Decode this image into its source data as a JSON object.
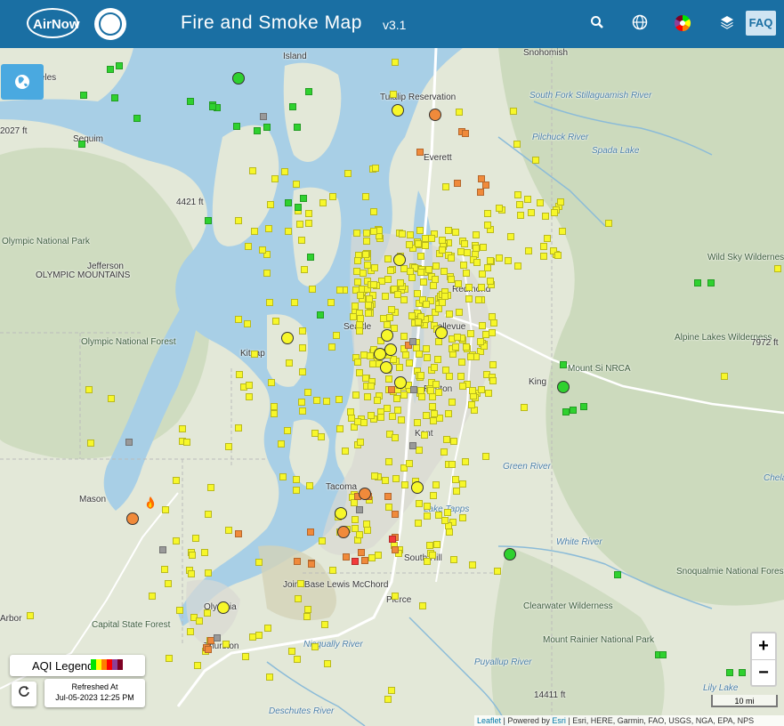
{
  "header": {
    "logo_text": "AirNow",
    "title": "Fire and Smoke Map",
    "version": "v3.1",
    "faq_label": "FAQ",
    "icons": [
      "search-icon",
      "globe-icon",
      "color-wheel-icon",
      "layers-icon"
    ]
  },
  "legend": {
    "label": "AQI Legend",
    "colors": [
      "#00e400",
      "#ffff00",
      "#ff7e00",
      "#ff0000",
      "#8f3f97",
      "#7e0023"
    ]
  },
  "refresh": {
    "title": "Refreshed At",
    "time": "Jul-05-2023 12:25 PM"
  },
  "zoom": {
    "in": "+",
    "out": "−"
  },
  "scale": "10 mi",
  "attribution": {
    "leaflet": "Leaflet",
    "sep1": " | Powered by ",
    "esri": "Esri",
    "rest": " | Esri, HERE, Garmin, FAO, USGS, NGA, EPA, NPS"
  },
  "places": [
    {
      "name": "t Angeles",
      "type": "city"
    },
    {
      "name": "Island",
      "type": "city"
    },
    {
      "name": "Snohomish",
      "type": "city"
    },
    {
      "name": "Tulalip Reservation",
      "type": "city"
    },
    {
      "name": "South Fork Stillaguamish River",
      "type": "river"
    },
    {
      "name": "Pilchuck River",
      "type": "river"
    },
    {
      "name": "Sequim",
      "type": "city"
    },
    {
      "name": "Everett",
      "type": "city"
    },
    {
      "name": "Spada Lake",
      "type": "river"
    },
    {
      "name": "4421 ft",
      "type": "city"
    },
    {
      "name": "Olympic National Park",
      "type": "park"
    },
    {
      "name": "Jefferson",
      "type": "city"
    },
    {
      "name": "OLYMPIC MOUNTAINS",
      "type": "city"
    },
    {
      "name": "Wild Sky Wilderness",
      "type": "park"
    },
    {
      "name": "Redmond",
      "type": "city"
    },
    {
      "name": "Seattle",
      "type": "city"
    },
    {
      "name": "Bellevue",
      "type": "city"
    },
    {
      "name": "Olympic National Forest",
      "type": "park"
    },
    {
      "name": "Kitsap",
      "type": "city"
    },
    {
      "name": "Alpine Lakes Wilderness",
      "type": "park"
    },
    {
      "name": "7972 ft",
      "type": "city"
    },
    {
      "name": "Mount Si NRCA",
      "type": "park"
    },
    {
      "name": "King",
      "type": "city"
    },
    {
      "name": "Renton",
      "type": "city"
    },
    {
      "name": "Kent",
      "type": "city"
    },
    {
      "name": "Green River",
      "type": "river"
    },
    {
      "name": "Mason",
      "type": "city"
    },
    {
      "name": "Tacoma",
      "type": "city"
    },
    {
      "name": "Lake Tapps",
      "type": "river"
    },
    {
      "name": "White River",
      "type": "river"
    },
    {
      "name": "South Hill",
      "type": "city"
    },
    {
      "name": "Joint Base Lewis McChord",
      "type": "city"
    },
    {
      "name": "Pierce",
      "type": "city"
    },
    {
      "name": "Snoqualmie National Forest",
      "type": "park"
    },
    {
      "name": "Clearwater Wilderness",
      "type": "park"
    },
    {
      "name": "Olympia",
      "type": "city"
    },
    {
      "name": "Capital State Forest",
      "type": "park"
    },
    {
      "name": "Thurston",
      "type": "city"
    },
    {
      "name": "Mount Rainier National Park",
      "type": "park"
    },
    {
      "name": "Nisqually River",
      "type": "river"
    },
    {
      "name": "Puyallup River",
      "type": "river"
    },
    {
      "name": "Deschutes River",
      "type": "river"
    },
    {
      "name": "14411 ft",
      "type": "city"
    },
    {
      "name": "Lily Lake",
      "type": "river"
    },
    {
      "name": "Chelan Lake",
      "type": "river"
    },
    {
      "name": "Arbor",
      "type": "city"
    },
    {
      "name": "2027 ft",
      "type": "city"
    }
  ]
}
